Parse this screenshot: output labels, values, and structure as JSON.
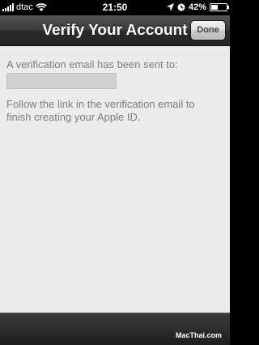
{
  "status_bar": {
    "carrier": "dtac",
    "time": "21:50",
    "battery": "42%",
    "battery_level": 0.42,
    "icons": [
      "signal-icon",
      "wifi-icon",
      "location-icon",
      "alarm-icon",
      "battery-icon"
    ]
  },
  "nav_bar": {
    "title": "Verify Your Account",
    "done_label": "Done"
  },
  "content": {
    "sent_message": "A verification email has been sent to:",
    "email_value": "",
    "instructions": "Follow the link in the verification email to finish creating your Apple ID."
  },
  "footer": {
    "watermark": "MacThai.com"
  },
  "colors": {
    "content_bg": "#ececec",
    "text_gray": "#7d7d7d",
    "nav_bg": "#3a3a3a"
  }
}
